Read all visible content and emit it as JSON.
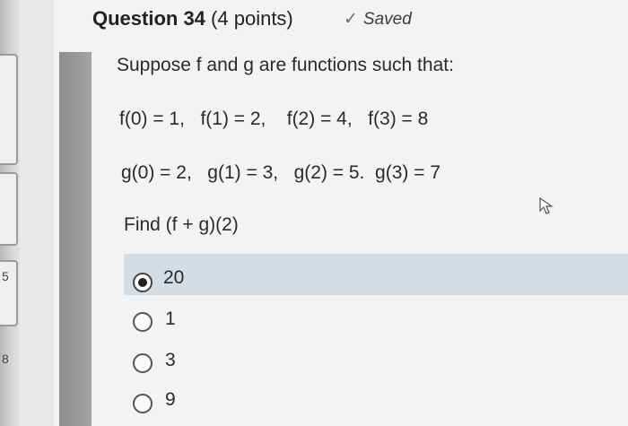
{
  "question": {
    "number_label": "Question 34",
    "points_label": "(4 points)",
    "saved_label": "Saved"
  },
  "body": {
    "prompt": "Suppose f and g are functions such that:",
    "f_values": "f(0) = 1,   f(1) = 2,    f(2) = 4,   f(3) = 8",
    "g_values": "g(0) = 2,   g(1) = 3,   g(2) = 5.  g(3) = 7",
    "ask": "Find (f + g)(2)"
  },
  "options": [
    {
      "label": "20",
      "selected": true
    },
    {
      "label": "1",
      "selected": false
    },
    {
      "label": "3",
      "selected": false
    },
    {
      "label": "9",
      "selected": false
    }
  ],
  "edge": {
    "num_a": "5",
    "num_b": "8"
  },
  "colors": {
    "highlight": "#d3dde6",
    "sidebar_bar": "#8d8d8d"
  }
}
